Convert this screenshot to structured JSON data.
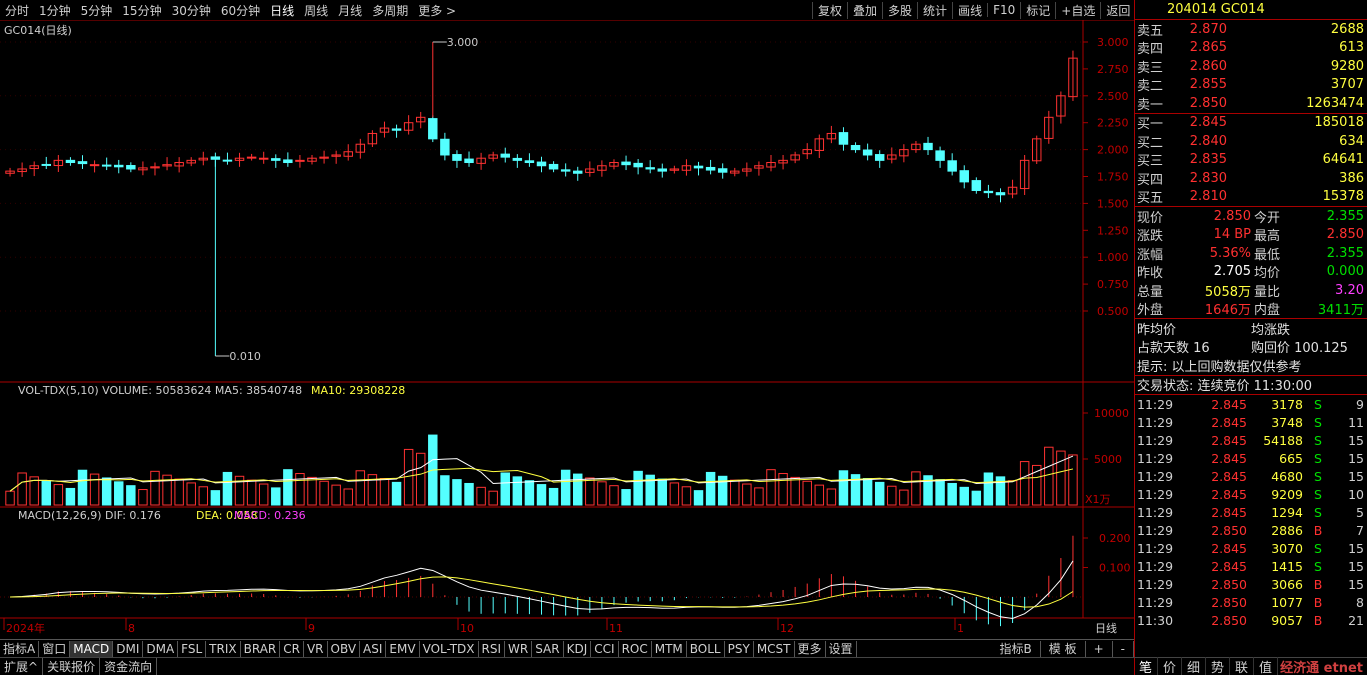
{
  "toolbar": {
    "periods": [
      "分时",
      "1分钟",
      "5分钟",
      "15分钟",
      "30分钟",
      "60分钟",
      "日线",
      "周线",
      "月线",
      "多周期",
      "更多 >"
    ],
    "active_period": "日线",
    "tools": [
      "复权",
      "叠加",
      "多股",
      "统计",
      "画线",
      "F10",
      "标记",
      "+自选",
      "返回"
    ]
  },
  "chart": {
    "title": "GC014(日线)",
    "price_axis": [
      "3.000",
      "2.750",
      "2.500",
      "2.250",
      "2.000",
      "1.750",
      "1.500",
      "1.250",
      "1.000",
      "0.750",
      "0.500"
    ],
    "max_label": "3.000",
    "min_label": "0.010",
    "vol_label": "VOL-TDX(5,10)",
    "vol_values": "VOLUME: 50583624  MA5: 38540748",
    "vol_ma10": "MA10: 29308228",
    "vol_axis": [
      "10000",
      "5000"
    ],
    "vol_unit": "X1万",
    "macd_label": "MACD(12,26,9)",
    "macd_dif": "DIF: 0.176",
    "macd_dea": "DEA: 0.058",
    "macd_val": "MACD: 0.236",
    "macd_axis": [
      "0.200",
      "0.100"
    ],
    "date_labels": [
      "2024年",
      "8",
      "9",
      "10",
      "11",
      "12",
      "1"
    ],
    "period_label": "日线"
  },
  "chart_data": {
    "type": "candlestick",
    "price_range": [
      0.3,
      3.1
    ],
    "series_close_approx": [
      1.8,
      1.82,
      1.85,
      1.86,
      1.9,
      1.88,
      1.87,
      1.86,
      1.85,
      1.84,
      1.82,
      1.83,
      1.84,
      1.86,
      1.88,
      1.9,
      1.92,
      1.91,
      1.9,
      1.92,
      1.93,
      1.92,
      1.9,
      1.88,
      1.9,
      1.92,
      1.93,
      1.95,
      1.98,
      2.05,
      2.15,
      2.2,
      2.18,
      2.25,
      2.3,
      2.1,
      1.95,
      1.9,
      1.88,
      1.92,
      1.95,
      1.93,
      1.9,
      1.88,
      1.85,
      1.82,
      1.8,
      1.78,
      1.82,
      1.85,
      1.88,
      1.86,
      1.84,
      1.82,
      1.8,
      1.82,
      1.85,
      1.83,
      1.81,
      1.79,
      1.8,
      1.82,
      1.85,
      1.88,
      1.9,
      1.95,
      2.0,
      2.1,
      2.15,
      2.05,
      2.0,
      1.95,
      1.9,
      1.95,
      2.0,
      2.05,
      2.0,
      1.9,
      1.8,
      1.7,
      1.62,
      1.6,
      1.58,
      1.65,
      1.9,
      2.1,
      2.3,
      2.5,
      2.85
    ]
  },
  "quotes": {
    "code": "204014 GC014",
    "asks": [
      {
        "label": "卖五",
        "price": "2.870",
        "vol": "2688"
      },
      {
        "label": "卖四",
        "price": "2.865",
        "vol": "613"
      },
      {
        "label": "卖三",
        "price": "2.860",
        "vol": "9280"
      },
      {
        "label": "卖二",
        "price": "2.855",
        "vol": "3707"
      },
      {
        "label": "卖一",
        "price": "2.850",
        "vol": "1263474"
      }
    ],
    "bids": [
      {
        "label": "买一",
        "price": "2.845",
        "vol": "185018"
      },
      {
        "label": "买二",
        "price": "2.840",
        "vol": "634"
      },
      {
        "label": "买三",
        "price": "2.835",
        "vol": "64641"
      },
      {
        "label": "买四",
        "price": "2.830",
        "vol": "386"
      },
      {
        "label": "买五",
        "price": "2.810",
        "vol": "15378"
      }
    ],
    "stats": [
      {
        "a": "现价",
        "b": "2.850",
        "bc": "red",
        "c": "今开",
        "d": "2.355",
        "dc": "grn"
      },
      {
        "a": "涨跌",
        "b": "14 BP",
        "bc": "red",
        "c": "最高",
        "d": "2.850",
        "dc": "red"
      },
      {
        "a": "涨幅",
        "b": "5.36%",
        "bc": "red",
        "c": "最低",
        "d": "2.355",
        "dc": "grn"
      },
      {
        "a": "昨收",
        "b": "2.705",
        "bc": "wht",
        "c": "均价",
        "d": "0.000",
        "dc": "grn"
      },
      {
        "a": "总量",
        "b": "5058万",
        "bc": "yel",
        "c": "量比",
        "d": "3.20",
        "dc": "mag"
      },
      {
        "a": "外盘",
        "b": "1646万",
        "bc": "red",
        "c": "内盘",
        "d": "3411万",
        "dc": "grn"
      }
    ],
    "extra1_l": "昨均价",
    "extra1_r": "均涨跌",
    "extra2_l": "占款天数 16",
    "extra2_r": "购回价  100.125",
    "hint": "提示: 以上回购数据仅供参考",
    "status": "交易状态: 连续竞价 11:30:00",
    "ticks": [
      {
        "t": "11:29",
        "p": "2.845",
        "v": "3178",
        "s": "S",
        "n": "9"
      },
      {
        "t": "11:29",
        "p": "2.845",
        "v": "3748",
        "s": "S",
        "n": "11"
      },
      {
        "t": "11:29",
        "p": "2.845",
        "v": "54188",
        "s": "S",
        "n": "15"
      },
      {
        "t": "11:29",
        "p": "2.845",
        "v": "665",
        "s": "S",
        "n": "15"
      },
      {
        "t": "11:29",
        "p": "2.845",
        "v": "4680",
        "s": "S",
        "n": "15"
      },
      {
        "t": "11:29",
        "p": "2.845",
        "v": "9209",
        "s": "S",
        "n": "10"
      },
      {
        "t": "11:29",
        "p": "2.845",
        "v": "1294",
        "s": "S",
        "n": "5"
      },
      {
        "t": "11:29",
        "p": "2.850",
        "v": "2886",
        "s": "B",
        "n": "7"
      },
      {
        "t": "11:29",
        "p": "2.845",
        "v": "3070",
        "s": "S",
        "n": "15"
      },
      {
        "t": "11:29",
        "p": "2.845",
        "v": "1415",
        "s": "S",
        "n": "15"
      },
      {
        "t": "11:29",
        "p": "2.850",
        "v": "3066",
        "s": "B",
        "n": "15"
      },
      {
        "t": "11:29",
        "p": "2.850",
        "v": "1077",
        "s": "B",
        "n": "8"
      },
      {
        "t": "11:30",
        "p": "2.850",
        "v": "9057",
        "s": "B",
        "n": "21"
      }
    ]
  },
  "bottom_tabs": [
    "指标A",
    "窗口",
    "MACD",
    "DMI",
    "DMA",
    "FSL",
    "TRIX",
    "BRAR",
    "CR",
    "VR",
    "OBV",
    "ASI",
    "EMV",
    "VOL-TDX",
    "RSI",
    "WR",
    "SAR",
    "KDJ",
    "CCI",
    "ROC",
    "MTM",
    "BOLL",
    "PSY",
    "MCST",
    "更多",
    "设置"
  ],
  "active_tab": "MACD",
  "bottom_right_tabs": [
    "指标B",
    "模 板",
    "+",
    "-"
  ],
  "bottom_tabs2": [
    "扩展^",
    "关联报价",
    "资金流向"
  ],
  "rp_tabs": [
    "笔",
    "价",
    "细",
    "势",
    "联",
    "值"
  ],
  "watermark": "经济通 etnet"
}
